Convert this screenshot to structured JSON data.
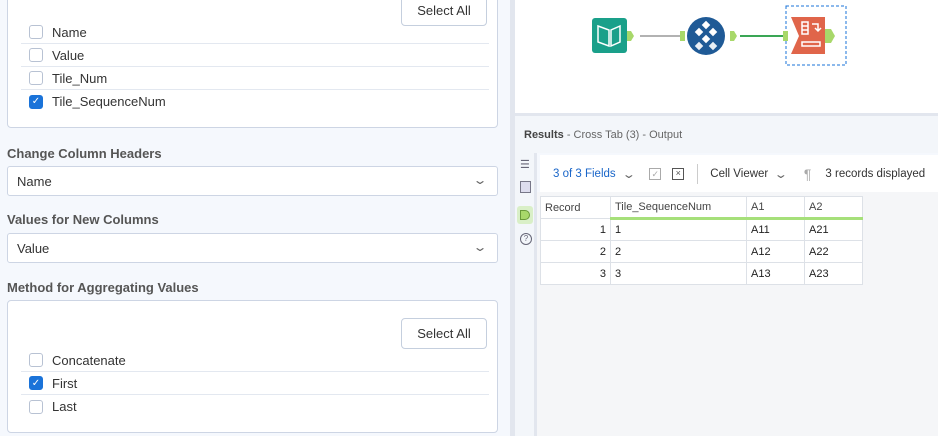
{
  "fields_card": {
    "select_all": "Select All",
    "items": [
      {
        "label": "Name",
        "checked": false
      },
      {
        "label": "Value",
        "checked": false
      },
      {
        "label": "Tile_Num",
        "checked": false
      },
      {
        "label": "Tile_SequenceNum",
        "checked": true
      }
    ]
  },
  "change_headers": {
    "label": "Change Column Headers",
    "value": "Name"
  },
  "values_new": {
    "label": "Values for New Columns",
    "value": "Value"
  },
  "method": {
    "label": "Method for Aggregating Values",
    "select_all": "Select All",
    "items": [
      {
        "label": "Concatenate",
        "checked": false
      },
      {
        "label": "First",
        "checked": true
      },
      {
        "label": "Last",
        "checked": false
      }
    ]
  },
  "results": {
    "title": "Results",
    "subtitle": "- Cross Tab (3) - Output"
  },
  "toolbar": {
    "fields": "3 of 3 Fields",
    "cell_viewer": "Cell Viewer",
    "records": "3 records displayed"
  },
  "table": {
    "headers": [
      "Record",
      "Tile_SequenceNum",
      "A1",
      "A2"
    ],
    "rows": [
      [
        "1",
        "1",
        "A11",
        "A21"
      ],
      [
        "2",
        "2",
        "A12",
        "A22"
      ],
      [
        "3",
        "3",
        "A13",
        "A23"
      ]
    ]
  },
  "colors": {
    "accent": "#1a73d9",
    "input_tool": "#1aa08a",
    "tile_tool": "#1f5a96",
    "crosstab_tool": "#e0654a"
  }
}
